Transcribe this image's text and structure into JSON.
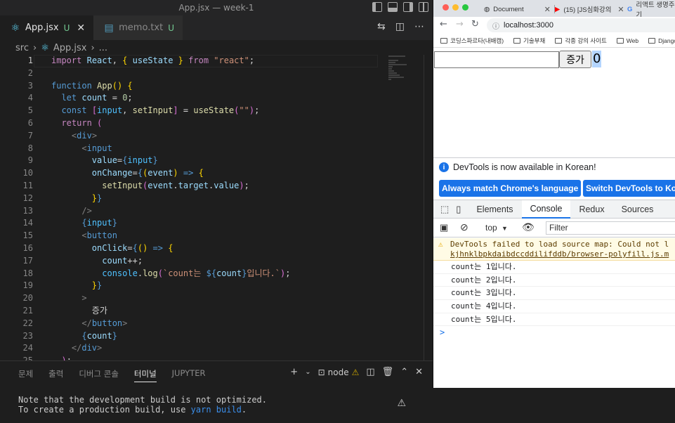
{
  "vscode": {
    "window_title": "App.jsx — week-1",
    "tabs": [
      {
        "label": "App.jsx",
        "status": "U",
        "icon": "react-icon"
      },
      {
        "label": "memo.txt",
        "status": "U",
        "icon": "file-icon"
      }
    ],
    "breadcrumb": {
      "folder": "src",
      "file": "App.jsx",
      "rest": "..."
    },
    "line_numbers": [
      "1",
      "2",
      "3",
      "4",
      "5",
      "6",
      "7",
      "8",
      "9",
      "10",
      "11",
      "12",
      "13",
      "14",
      "15",
      "16",
      "17",
      "18",
      "19",
      "20",
      "21",
      "22",
      "23",
      "24",
      "25"
    ],
    "panel": {
      "tabs": [
        "문제",
        "출력",
        "디버그 콘솔",
        "터미널",
        "JUPYTER"
      ],
      "active_tab": "터미널",
      "terminal_name": "node",
      "output_line1": "Note that the development build is not optimized.",
      "output_line2_prefix": "To create a production build, use ",
      "output_line2_cmd": "yarn build",
      "output_line2_suffix": "."
    }
  },
  "chrome": {
    "tabs": [
      {
        "label": "Document"
      },
      {
        "label": "(15) [JS심화강의"
      },
      {
        "label": "리액트 생명주기"
      }
    ],
    "url": "localhost:3000",
    "bookmarks": [
      "코딩스파르타(내배캠)",
      "기술부채",
      "각종 강의 사이트",
      "Web",
      "Django&P"
    ],
    "page": {
      "input_value": "",
      "button_label": "증가",
      "count_text": "0"
    },
    "devtools": {
      "banner_text": "DevTools is now available in Korean!",
      "btn_match": "Always match Chrome's language",
      "btn_switch": "Switch DevTools to Ko",
      "tabs": [
        "Elements",
        "Console",
        "Redux",
        "Sources"
      ],
      "active_tab": "Console",
      "context": "top",
      "filter_placeholder": "Filter",
      "warning_line1": "DevTools failed to load source map: Could not l",
      "warning_line2": "kjhnklbpkdaibdccddilifddb/browser-polyfill.js.m",
      "logs": [
        "count는 1입니다.",
        "count는 2입니다.",
        "count는 3입니다.",
        "count는 4입니다.",
        "count는 5입니다."
      ],
      "prompt": ">"
    }
  }
}
